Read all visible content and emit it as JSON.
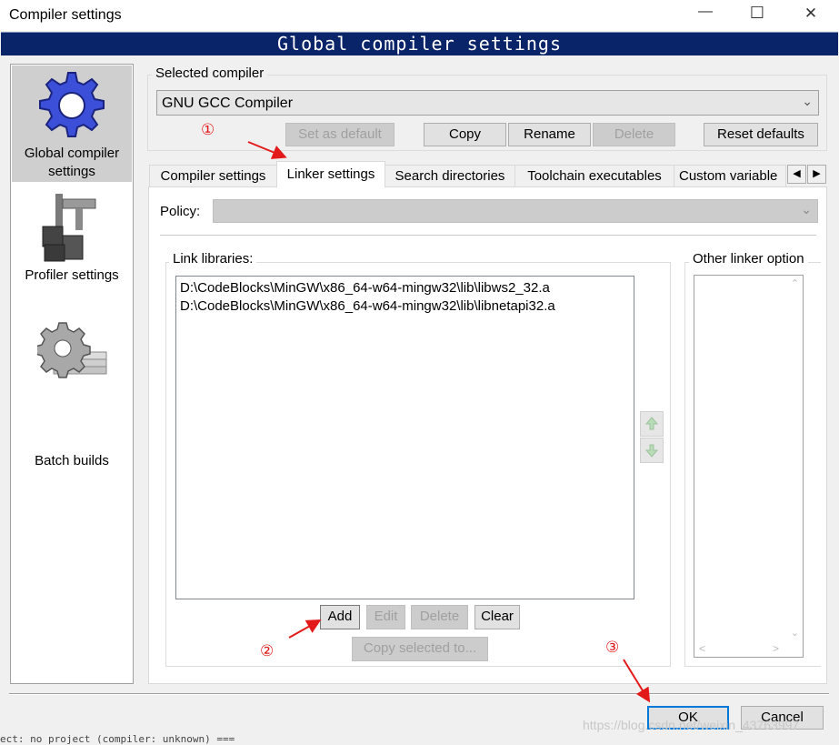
{
  "window": {
    "title": "Compiler settings",
    "controls": {
      "minimize": "—",
      "maximize": "☐",
      "close": "✕"
    }
  },
  "banner": {
    "text": "Global compiler settings"
  },
  "sidebar": {
    "items": [
      {
        "label": "Global compiler settings",
        "icon": "gear-icon"
      },
      {
        "label": "Profiler settings",
        "icon": "caliper-icon"
      },
      {
        "label": "Batch builds",
        "icon": "batch-gear-icon"
      }
    ]
  },
  "compiler_group": {
    "title": "Selected compiler",
    "selected": "GNU GCC Compiler",
    "buttons": {
      "set_default": "Set as default",
      "copy": "Copy",
      "rename": "Rename",
      "delete": "Delete",
      "reset": "Reset defaults"
    }
  },
  "tabs": [
    "Compiler settings",
    "Linker settings",
    "Search directories",
    "Toolchain executables",
    "Custom variable"
  ],
  "policy": {
    "label": "Policy:",
    "value": ""
  },
  "link_libraries": {
    "title": "Link libraries:",
    "items": [
      "D:\\CodeBlocks\\MinGW\\x86_64-w64-mingw32\\lib\\libws2_32.a",
      "D:\\CodeBlocks\\MinGW\\x86_64-w64-mingw32\\lib\\libnetapi32.a"
    ],
    "buttons": {
      "add": "Add",
      "edit": "Edit",
      "delete": "Delete",
      "clear": "Clear",
      "copy_selected": "Copy selected to..."
    }
  },
  "other_linker": {
    "title": "Other linker option"
  },
  "dialog_buttons": {
    "ok": "OK",
    "cancel": "Cancel"
  },
  "annotations": {
    "step1": "①",
    "step2": "②",
    "step3": "③"
  },
  "watermark": "https://blog.csdn.net/weixin_43763997",
  "background_text": "ect: no project (compiler: unknown) ===",
  "colors": {
    "banner_bg": "#0a246a",
    "banner_text": "#ffffff",
    "annotation_red": "#e31a1a",
    "default_button_border": "#0078d7"
  }
}
